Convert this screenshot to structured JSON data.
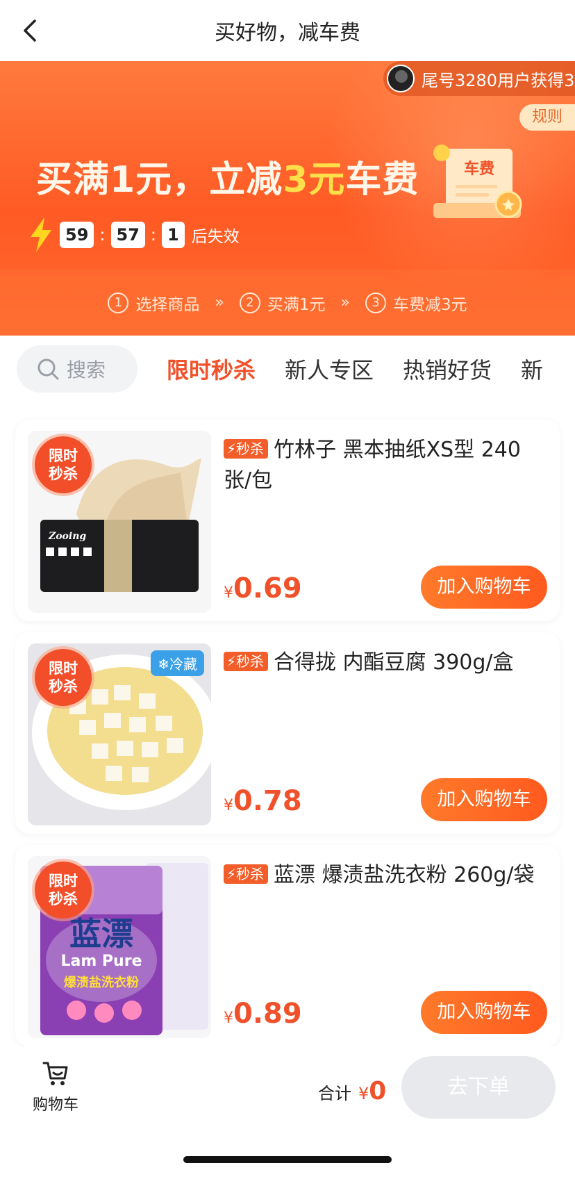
{
  "header": {
    "title": "买好物，减车费"
  },
  "banner": {
    "ticker_text": "尾号3280用户获得3",
    "rules_label": "规则",
    "headline_before": "买满1元，立减",
    "headline_highlight": "3元",
    "headline_after": "车费",
    "bill_label": "车费",
    "timer": {
      "minutes": "59",
      "seconds": "57",
      "tenths": "1",
      "suffix": "后失效"
    },
    "steps": [
      {
        "num": "1",
        "label": "选择商品"
      },
      {
        "num": "2",
        "label": "买满1元"
      },
      {
        "num": "3",
        "label": "车费减3元"
      }
    ],
    "step_arrow": "»"
  },
  "tabs": {
    "search_placeholder": "搜索",
    "items": [
      "限时秒杀",
      "新人专区",
      "热销好货",
      "新"
    ]
  },
  "products": [
    {
      "badge": "限时\n秒杀",
      "badge_line1": "限时",
      "badge_line2": "秒杀",
      "tag": "秒杀",
      "name": "竹林子 黑本抽纸XS型 240张/包",
      "yen": "¥",
      "price": "0.69",
      "button": "加入购物车",
      "cold_tag": ""
    },
    {
      "badge_line1": "限时",
      "badge_line2": "秒杀",
      "tag": "秒杀",
      "name": "合得拢 内酯豆腐 390g/盒",
      "yen": "¥",
      "price": "0.78",
      "button": "加入购物车",
      "cold_tag": "❄冷藏"
    },
    {
      "badge_line1": "限时",
      "badge_line2": "秒杀",
      "tag": "秒杀",
      "name": "蓝漂 爆渍盐洗衣粉 260g/袋",
      "yen": "¥",
      "price": "0.89",
      "button": "加入购物车",
      "cold_tag": ""
    }
  ],
  "product_image_text": {
    "tissue_brand": "Zooing",
    "detergent_brand_cn": "蓝漂",
    "detergent_brand_en": "Lam Pure",
    "detergent_sub": "爆渍盐洗衣粉"
  },
  "footer": {
    "cart_label": "购物车",
    "total_label": "合计",
    "yen": "¥",
    "total_amount": "0",
    "checkout_label": "去下单"
  },
  "colors": {
    "accent": "#f0512a",
    "banner": "#ff5a24",
    "highlight": "#ffe04a"
  }
}
